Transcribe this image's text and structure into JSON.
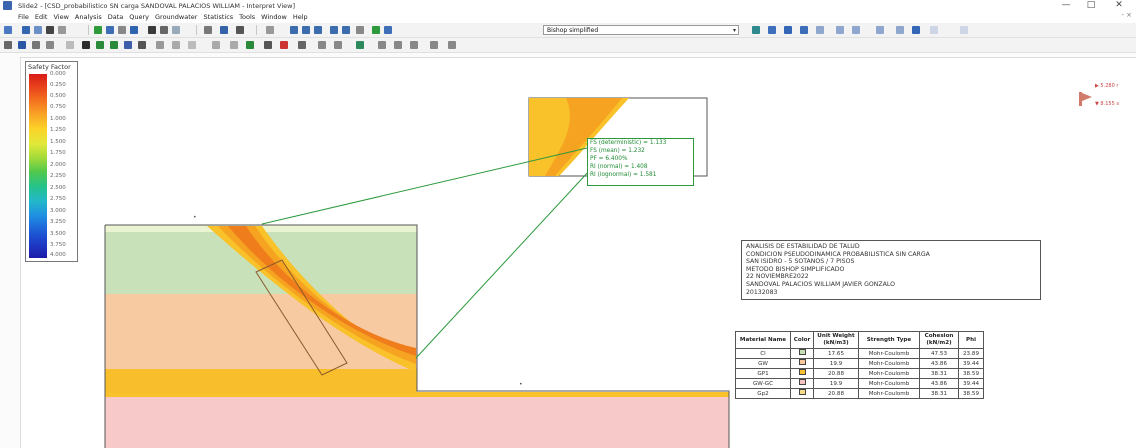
{
  "window": {
    "title": "Slide2 - [CSD_probabilistico SN carga SANDOVAL PALACIOS WILLIAM - Interpret View]",
    "minimize": "—",
    "maximize": "□",
    "close": "✕"
  },
  "menu": {
    "items": [
      "File",
      "Edit",
      "View",
      "Analysis",
      "Data",
      "Query",
      "Groundwater",
      "Statistics",
      "Tools",
      "Window",
      "Help"
    ],
    "right": "- ×"
  },
  "toolbar": {
    "method_combo": "Bishop simplified"
  },
  "legend": {
    "title": "Safety Factor",
    "values": [
      "0.000",
      "0.250",
      "0.500",
      "0.750",
      "1.000",
      "1.250",
      "1.500",
      "1.750",
      "2.000",
      "2.250",
      "2.500",
      "2.750",
      "3.000",
      "3.250",
      "3.500",
      "3.750",
      "4.000"
    ],
    "colors": [
      "#d81c18",
      "#e8421b",
      "#f36f1e",
      "#f9a427",
      "#fcd428",
      "#e2e83a",
      "#9fda3a",
      "#52c84b",
      "#25c38a",
      "#23b8c9",
      "#1f8fe2",
      "#1e5fd8",
      "#1e3cc7",
      "#1d1ba8"
    ]
  },
  "callout": {
    "lines": [
      "FS (deterministic) = 1.133",
      "FS (mean) = 1.232",
      "PF = 6.400%",
      "RI (normal) = 1.408",
      "RI (lognormal) = 1.581"
    ]
  },
  "info": {
    "lines": [
      "ANALISIS DE ESTABILIDAD DE TALUD",
      "CONDICION PSEUDODINAMICA PROBABILISTICA SIN CARGA",
      "SAN ISIDRO - 5 SOTANOS / 7 PISOS",
      "METODO BISHOP SIMPLIFICADO",
      "22 NOVIEMBRE2022",
      "SANDOVAL PALACIOS WILLIAM JAVIER GONZALO",
      "20132083"
    ]
  },
  "materials": {
    "headers": [
      "Material Name",
      "Color",
      "Unit Weight (kN/m3)",
      "Strength Type",
      "Cohesion (kN/m2)",
      "Phi"
    ],
    "rows": [
      {
        "name": "Cl",
        "color": "#c8dfb8",
        "unit_weight": "17.65",
        "strength": "Mohr-Coulomb",
        "cohesion": "47.53",
        "phi": "23.89"
      },
      {
        "name": "GW",
        "color": "#f8c79c",
        "unit_weight": "19.9",
        "strength": "Mohr-Coulomb",
        "cohesion": "43.86",
        "phi": "39.44"
      },
      {
        "name": "GP1",
        "color": "#f9c02d",
        "unit_weight": "20.88",
        "strength": "Mohr-Coulomb",
        "cohesion": "38.31",
        "phi": "38.59"
      },
      {
        "name": "GW-GC",
        "color": "#f6c2c2",
        "unit_weight": "19.9",
        "strength": "Mohr-Coulomb",
        "cohesion": "43.86",
        "phi": "39.44"
      },
      {
        "name": "Gp2",
        "color": "#f8d98a",
        "unit_weight": "20.88",
        "strength": "Mohr-Coulomb",
        "cohesion": "38.31",
        "phi": "38.59"
      }
    ]
  },
  "markers": {
    "top_right_upper": "▶ 5.280 r",
    "top_right_lower": "▼ 8.155 s"
  },
  "colors": {
    "clay_layer": "#c9e1b9",
    "sand_layer": "#f8caa2",
    "gravel_layer": "#f8be2c",
    "base_layer": "#f7c9c9",
    "top_strip": "#eaf3d2",
    "callout_line": "#2c9a3c",
    "slip_outer": "#f9c12a",
    "slip_mid": "#f5a320",
    "slip_inner": "#f07d1c"
  }
}
